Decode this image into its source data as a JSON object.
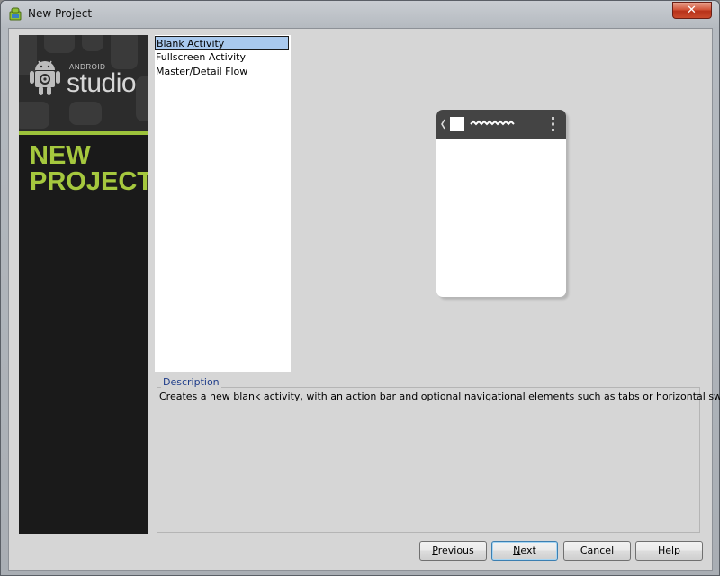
{
  "window": {
    "title": "New Project",
    "close_glyph": "✕"
  },
  "banner": {
    "brand_small": "ANDROID",
    "brand_large": "studio",
    "heading_line1": "NEW",
    "heading_line2": "PROJECT",
    "accent_color": "#9dc33b"
  },
  "templates": {
    "items": [
      {
        "label": "Blank Activity",
        "selected": true
      },
      {
        "label": "Fullscreen Activity",
        "selected": false
      },
      {
        "label": "Master/Detail Flow",
        "selected": false
      }
    ]
  },
  "description": {
    "legend": "Description",
    "text": "Creates a new blank activity, with an action bar and optional navigational elements such as tabs or horizontal swipe."
  },
  "buttons": {
    "previous": {
      "mnemonic": "P",
      "rest": "revious"
    },
    "next": {
      "mnemonic": "N",
      "rest": "ext"
    },
    "cancel": "Cancel",
    "help": "Help"
  },
  "icons": {
    "app": "android-studio-icon",
    "close": "close-icon",
    "robot": "android-robot-icon",
    "back": "back-chevron-icon",
    "overflow": "overflow-menu-icon"
  }
}
